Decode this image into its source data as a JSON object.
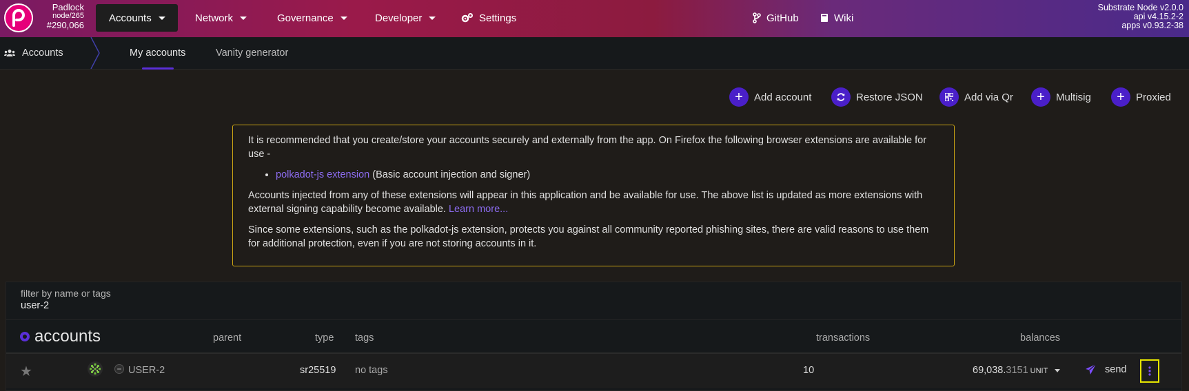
{
  "chain": {
    "name": "Padlock",
    "node": "node/265",
    "block": "#290,066"
  },
  "menu": {
    "accounts": "Accounts",
    "network": "Network",
    "governance": "Governance",
    "developer": "Developer",
    "settings": "Settings",
    "github": "GitHub",
    "wiki": "Wiki"
  },
  "version": {
    "node": "Substrate Node v2.0.0",
    "api": "api v4.15.2-2",
    "apps": "apps v0.93.2-38"
  },
  "subnav": {
    "section": "Accounts",
    "tabs": [
      "My accounts",
      "Vanity generator"
    ]
  },
  "actions": {
    "add_account": "Add account",
    "restore_json": "Restore JSON",
    "add_via_qr": "Add via Qr",
    "multisig": "Multisig",
    "proxied": "Proxied"
  },
  "notice": {
    "p1": "It is recommended that you create/store your accounts securely and externally from the app. On Firefox the following browser extensions are available for use -",
    "ext_link": "polkadot-js extension",
    "ext_desc": " (Basic account injection and signer)",
    "p2": "Accounts injected from any of these extensions will appear in this application and be available for use. The above list is updated as more extensions with external signing capability become available. ",
    "learn_more": "Learn more...",
    "p3": "Since some extensions, such as the polkadot-js extension, protects you against all community reported phishing sites, there are valid reasons to use them for additional protection, even if you are not storing accounts in it."
  },
  "filter": {
    "label": "filter by name or tags",
    "value": "user-2"
  },
  "table": {
    "title": "accounts",
    "headers": {
      "parent": "parent",
      "type": "type",
      "tags": "tags",
      "transactions": "transactions",
      "balances": "balances"
    },
    "rows": [
      {
        "name": "USER-2",
        "type": "sr25519",
        "tags": "no tags",
        "transactions": "10",
        "balance_int": "69,038.",
        "balance_dec": "3151",
        "unit": "UNIT",
        "send": "send"
      }
    ]
  },
  "colors": {
    "accent": "#5a2fd9",
    "highlight": "#e6e600",
    "notice_border": "#c9a314"
  }
}
